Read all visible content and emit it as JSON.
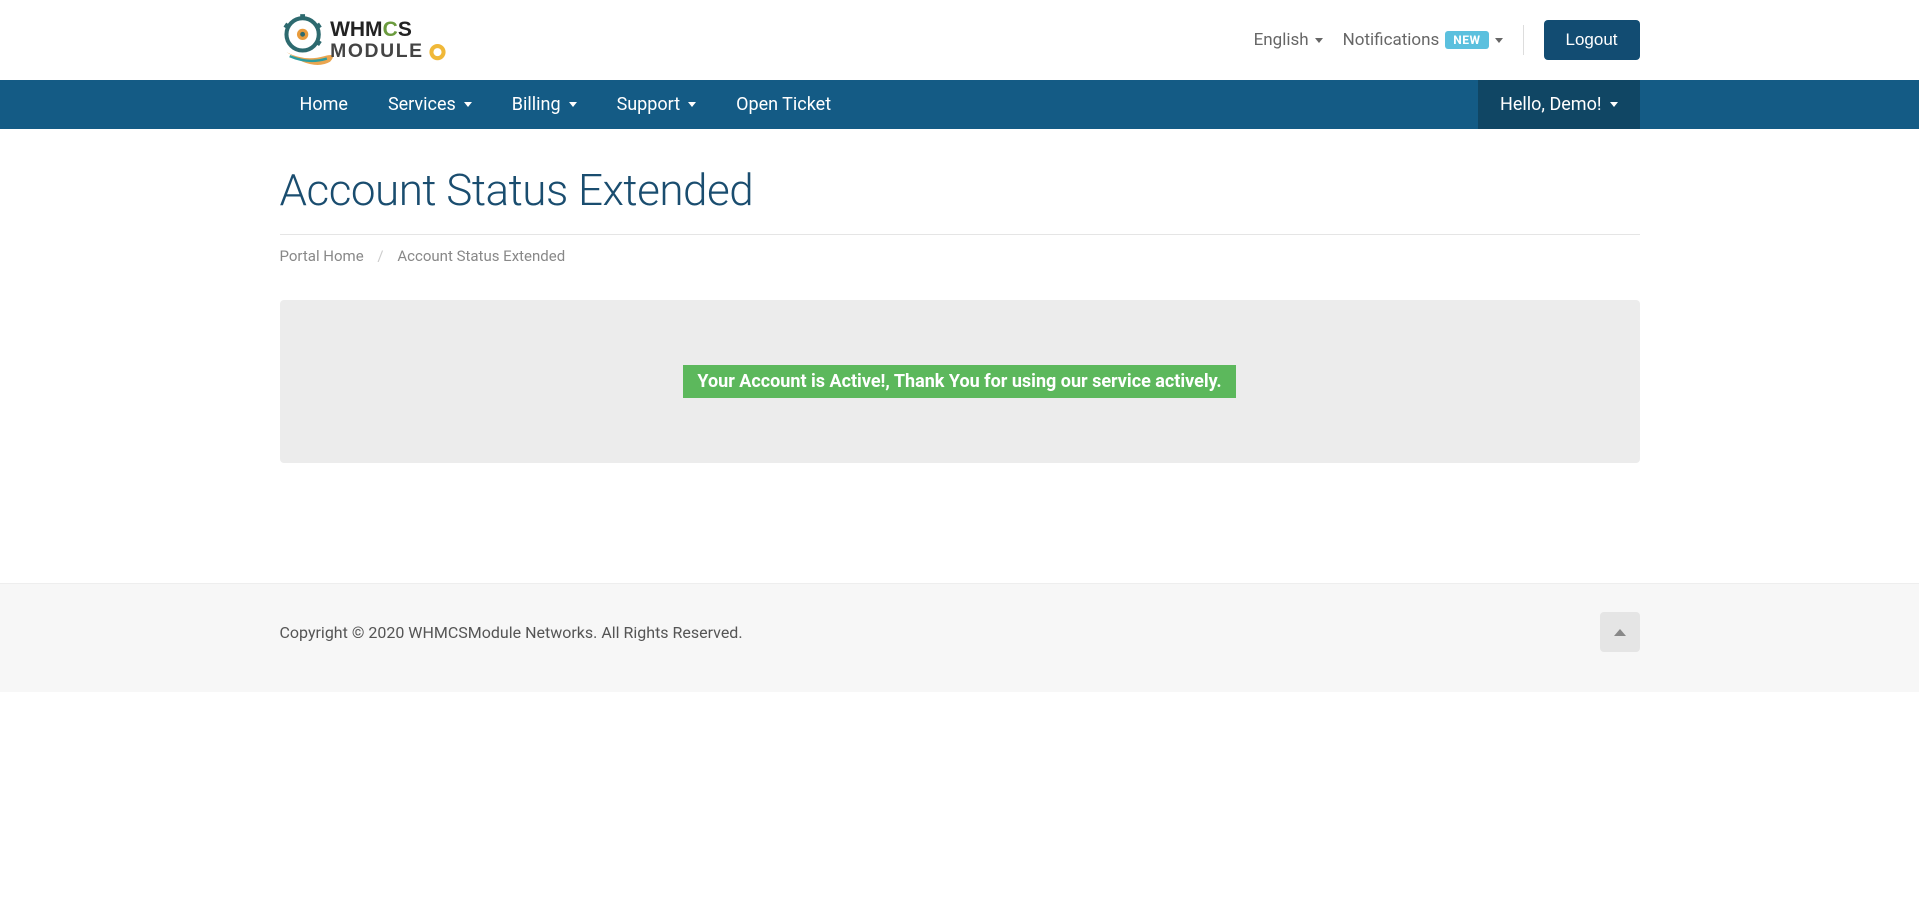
{
  "header": {
    "language": "English",
    "notifications_label": "Notifications",
    "notifications_badge": "NEW",
    "logout": "Logout"
  },
  "nav": {
    "items": [
      {
        "label": "Home",
        "dropdown": false
      },
      {
        "label": "Services",
        "dropdown": true
      },
      {
        "label": "Billing",
        "dropdown": true
      },
      {
        "label": "Support",
        "dropdown": true
      },
      {
        "label": "Open Ticket",
        "dropdown": false
      }
    ],
    "user_greeting": "Hello, Demo!"
  },
  "page": {
    "title": "Account Status Extended",
    "breadcrumb": {
      "home": "Portal Home",
      "sep": "/",
      "current": "Account Status Extended"
    },
    "alert_message": "Your Account is Active!, Thank You for using our service actively."
  },
  "footer": {
    "copyright": "Copyright © 2020 WHMCSModule Networks. All Rights Reserved."
  },
  "logo": {
    "brand_upper": "WHMCS",
    "brand_lower": "MODULE"
  }
}
